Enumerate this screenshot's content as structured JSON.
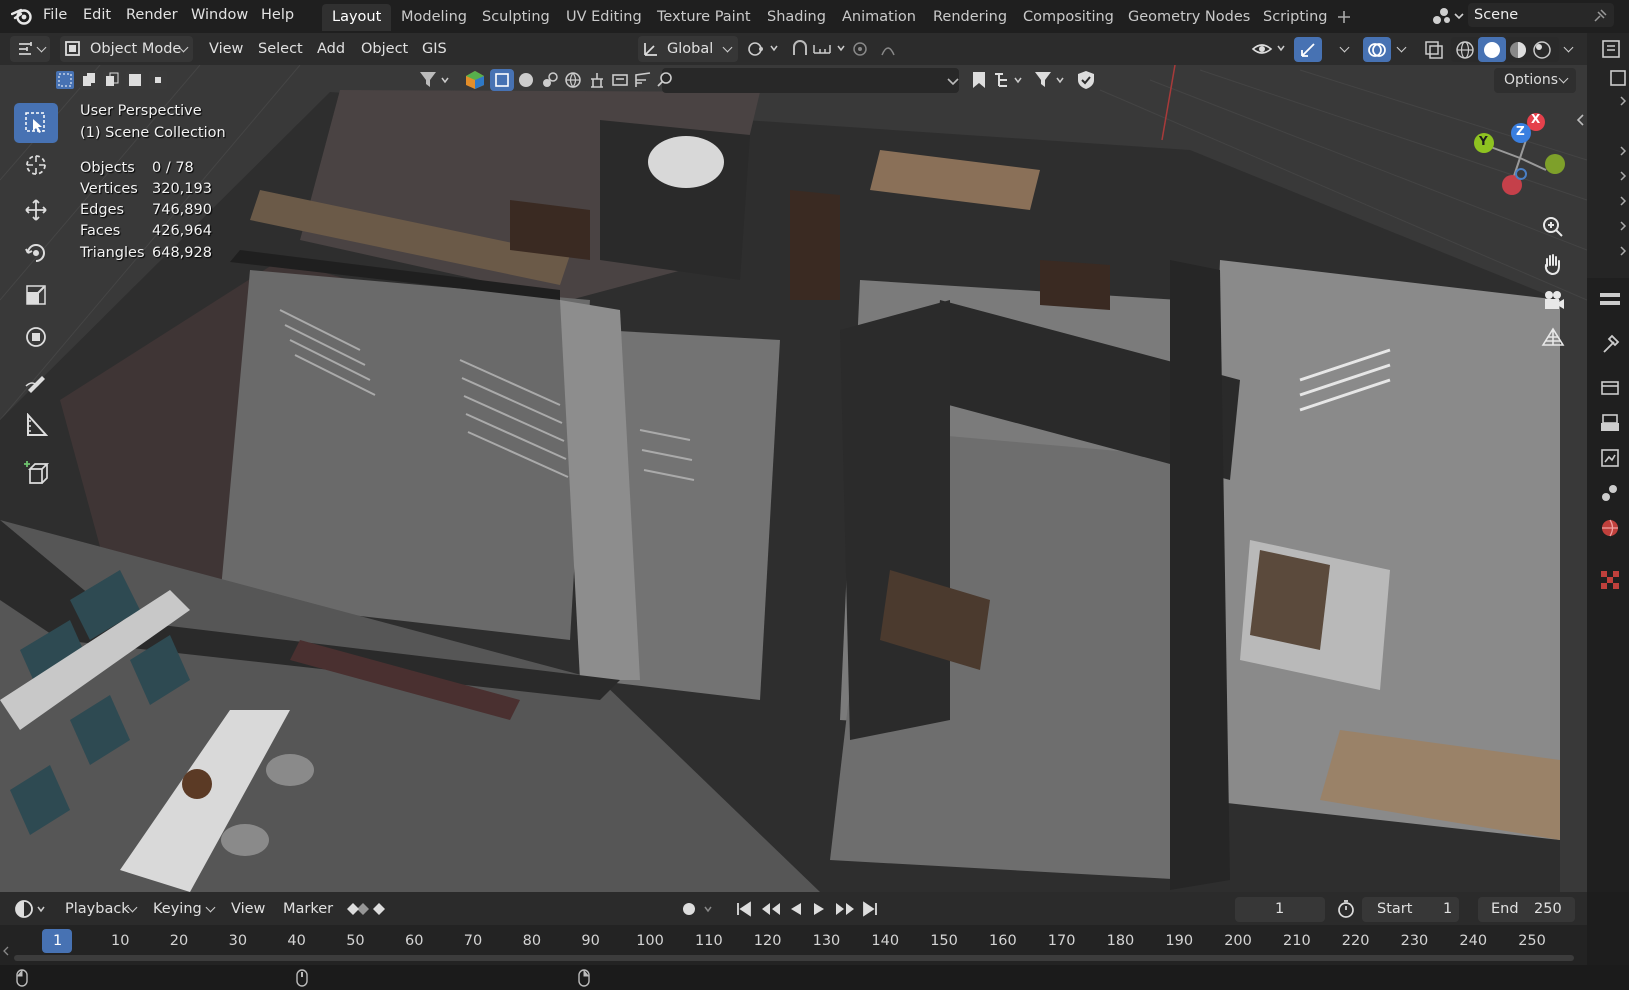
{
  "colors": {
    "accent": "#4772b3",
    "axis_x": "#e5414c",
    "axis_y": "#8ec321",
    "axis_z": "#3a7fe0"
  },
  "menu": {
    "file": "File",
    "edit": "Edit",
    "render": "Render",
    "window": "Window",
    "help": "Help"
  },
  "workspaces": [
    {
      "label": "Layout",
      "active": true
    },
    {
      "label": "Modeling"
    },
    {
      "label": "Sculpting"
    },
    {
      "label": "UV Editing"
    },
    {
      "label": "Texture Paint"
    },
    {
      "label": "Shading"
    },
    {
      "label": "Animation"
    },
    {
      "label": "Rendering"
    },
    {
      "label": "Compositing"
    },
    {
      "label": "Geometry Nodes"
    },
    {
      "label": "Scripting"
    }
  ],
  "scene": {
    "name": "Scene"
  },
  "viewport_header": {
    "mode": "Object Mode",
    "view": "View",
    "select": "Select",
    "add": "Add",
    "object": "Object",
    "gis": "GIS",
    "transform_orientation": "Global",
    "options": "Options"
  },
  "overlay": {
    "perspective": "User Perspective",
    "collection": "(1) Scene Collection",
    "stats": [
      {
        "label": "Objects",
        "value": "0 / 78"
      },
      {
        "label": "Vertices",
        "value": "320,193"
      },
      {
        "label": "Edges",
        "value": "746,890"
      },
      {
        "label": "Faces",
        "value": "426,964"
      },
      {
        "label": "Triangles",
        "value": "648,928"
      }
    ]
  },
  "gizmo": {
    "x": "X",
    "y": "Y",
    "z": "Z"
  },
  "tools": [
    "select-box-tool",
    "cursor-tool",
    "move-tool",
    "rotate-tool",
    "scale-tool",
    "transform-tool",
    "annotate-tool",
    "measure-tool",
    "add-cube-tool"
  ],
  "timeline": {
    "playback": "Playback",
    "keying": "Keying",
    "view": "View",
    "marker": "Marker",
    "current_frame": "1",
    "start_label": "Start",
    "start": "1",
    "end_label": "End",
    "end": "250",
    "ruler_current": "1",
    "ruler": [
      "10",
      "20",
      "30",
      "40",
      "50",
      "60",
      "70",
      "80",
      "90",
      "100",
      "110",
      "120",
      "130",
      "140",
      "150",
      "160",
      "170",
      "180",
      "190",
      "200",
      "210",
      "220",
      "230",
      "240",
      "250"
    ]
  }
}
